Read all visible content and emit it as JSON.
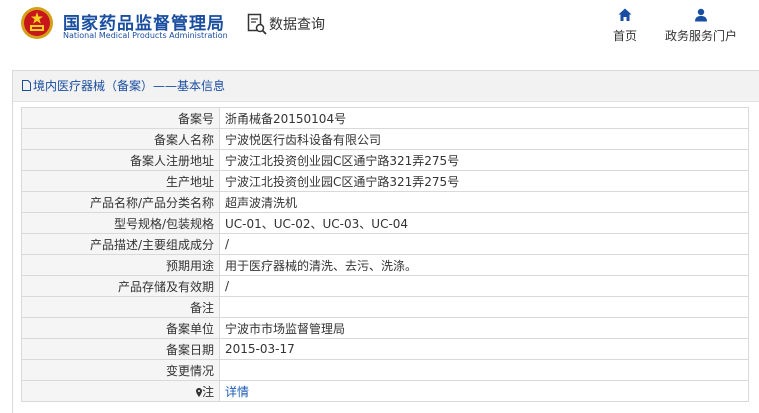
{
  "header": {
    "logo_cn": "国家药品监督管理局",
    "logo_en": "National Medical Products Administration",
    "query_title": "数据查询",
    "nav": [
      {
        "label": "首页",
        "icon": "home-icon"
      },
      {
        "label": "政务服务门户",
        "icon": "user-icon"
      }
    ]
  },
  "panel": {
    "title": "境内医疗器械（备案）——基本信息",
    "rows": [
      {
        "label": "备案号",
        "value": "浙甬械备20150104号"
      },
      {
        "label": "备案人名称",
        "value": "宁波悦医行齿科设备有限公司"
      },
      {
        "label": "备案人注册地址",
        "value": "宁波江北投资创业园C区通宁路321弄275号"
      },
      {
        "label": "生产地址",
        "value": "宁波江北投资创业园C区通宁路321弄275号"
      },
      {
        "label": "产品名称/产品分类名称",
        "value": "超声波清洗机"
      },
      {
        "label": "型号规格/包装规格",
        "value": "UC-01、UC-02、UC-03、UC-04"
      },
      {
        "label": "产品描述/主要组成成分",
        "value": "/"
      },
      {
        "label": "预期用途",
        "value": "用于医疗器械的清洗、去污、洗涤。"
      },
      {
        "label": "产品存储及有效期",
        "value": "/"
      },
      {
        "label": "备注",
        "value": ""
      },
      {
        "label": "备案单位",
        "value": "宁波市市场监督管理局"
      },
      {
        "label": "备案日期",
        "value": "2015-03-17"
      },
      {
        "label": "变更情况",
        "value": ""
      }
    ],
    "note": {
      "label": "注",
      "link": "详情"
    }
  },
  "colors": {
    "brand_blue": "#1a4ea0",
    "link_blue": "#1a5bb5",
    "label_bg": "#f5f5f5",
    "header_bg": "#f2f2f2"
  }
}
